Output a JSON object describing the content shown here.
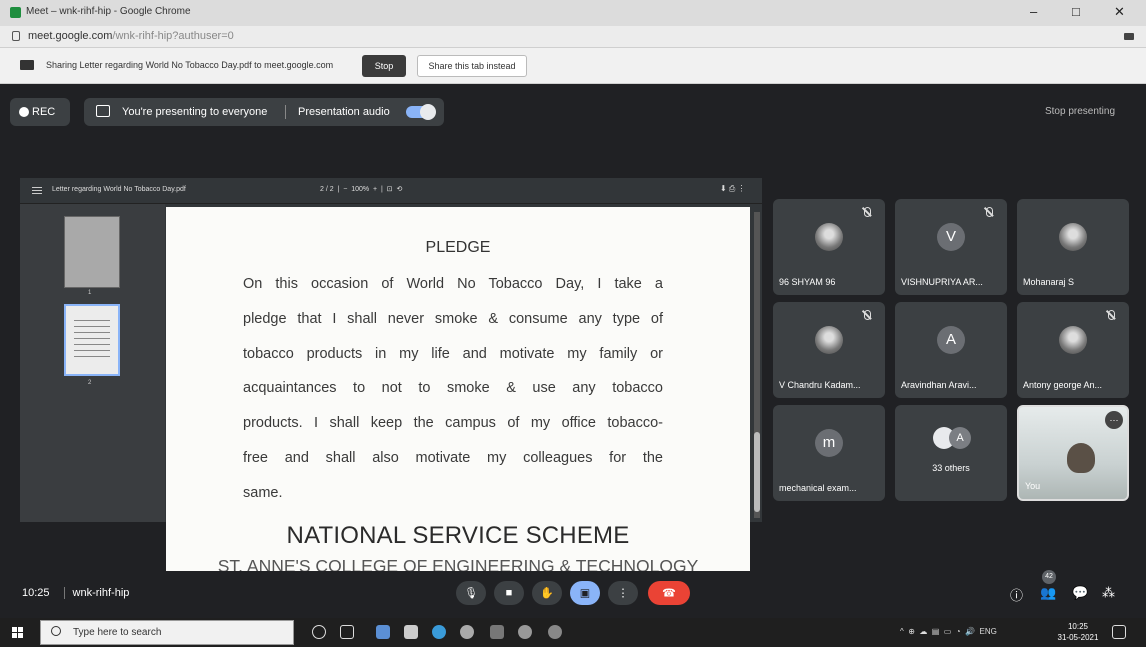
{
  "browser": {
    "title": "Meet – wnk-rihf-hip - Google Chrome",
    "url_host": "meet.google.com",
    "url_path": "/wnk-rihf-hip?authuser=0",
    "minimize": "–",
    "maximize": "□",
    "close": "✕"
  },
  "share_bar": {
    "text": "Sharing Letter regarding World No Tobacco Day.pdf to meet.google.com",
    "stop_label": "Stop",
    "share_tab_label": "Share this tab instead"
  },
  "meet_top": {
    "rec_label": "REC",
    "presenting_text": "You're presenting to everyone",
    "audio_label": "Presentation audio",
    "audio_on": true,
    "stop_presenting": "Stop presenting"
  },
  "pdf": {
    "file_name": "Letter regarding World No Tobacco Day.pdf",
    "page_indicator": "2 / 2",
    "zoom": "100%",
    "thumb_numbers": [
      "1",
      "2"
    ],
    "tools": "⬇ ⎙ ⋮",
    "pledge_title": "PLEDGE",
    "pledge_lines": [
      "On this occasion of World No Tobacco Day, I take a",
      "pledge that I shall never smoke & consume any type of",
      "tobacco products in my life and motivate my family or",
      "acquaintances to not to smoke & use any tobacco",
      "products. I shall keep the campus of my office tobacco-",
      "free and shall also motivate my colleagues for the",
      "same."
    ],
    "footer_title": "NATIONAL SERVICE SCHEME",
    "footer_subtitle": "ST. ANNE'S COLLEGE OF ENGINEERING & TECHNOLOGY"
  },
  "participants": [
    {
      "name": "96 SHYAM 96",
      "avatar": "photo",
      "muted": true
    },
    {
      "name": "VISHNUPRIYA AR...",
      "avatar": "V",
      "muted": true
    },
    {
      "name": "Mohanaraj S",
      "avatar": "photo",
      "muted": false
    },
    {
      "name": "V Chandru Kadam...",
      "avatar": "photo",
      "muted": true
    },
    {
      "name": "Aravindhan Aravi...",
      "avatar": "A",
      "muted": false
    },
    {
      "name": "Antony george An...",
      "avatar": "photo",
      "muted": true
    },
    {
      "name": "mechanical exam...",
      "avatar": "m",
      "muted": false
    },
    {
      "name": "33 others",
      "avatar": "A",
      "muted": false
    },
    {
      "name": "You",
      "avatar": "video",
      "muted": false
    }
  ],
  "bottom": {
    "time": "10:25",
    "meeting_code": "wnk-rihf-hip",
    "people_count": "42"
  },
  "taskbar": {
    "search_placeholder": "Type here to search",
    "lang": "ENG",
    "time": "10:25",
    "date": "31-05-2021"
  }
}
